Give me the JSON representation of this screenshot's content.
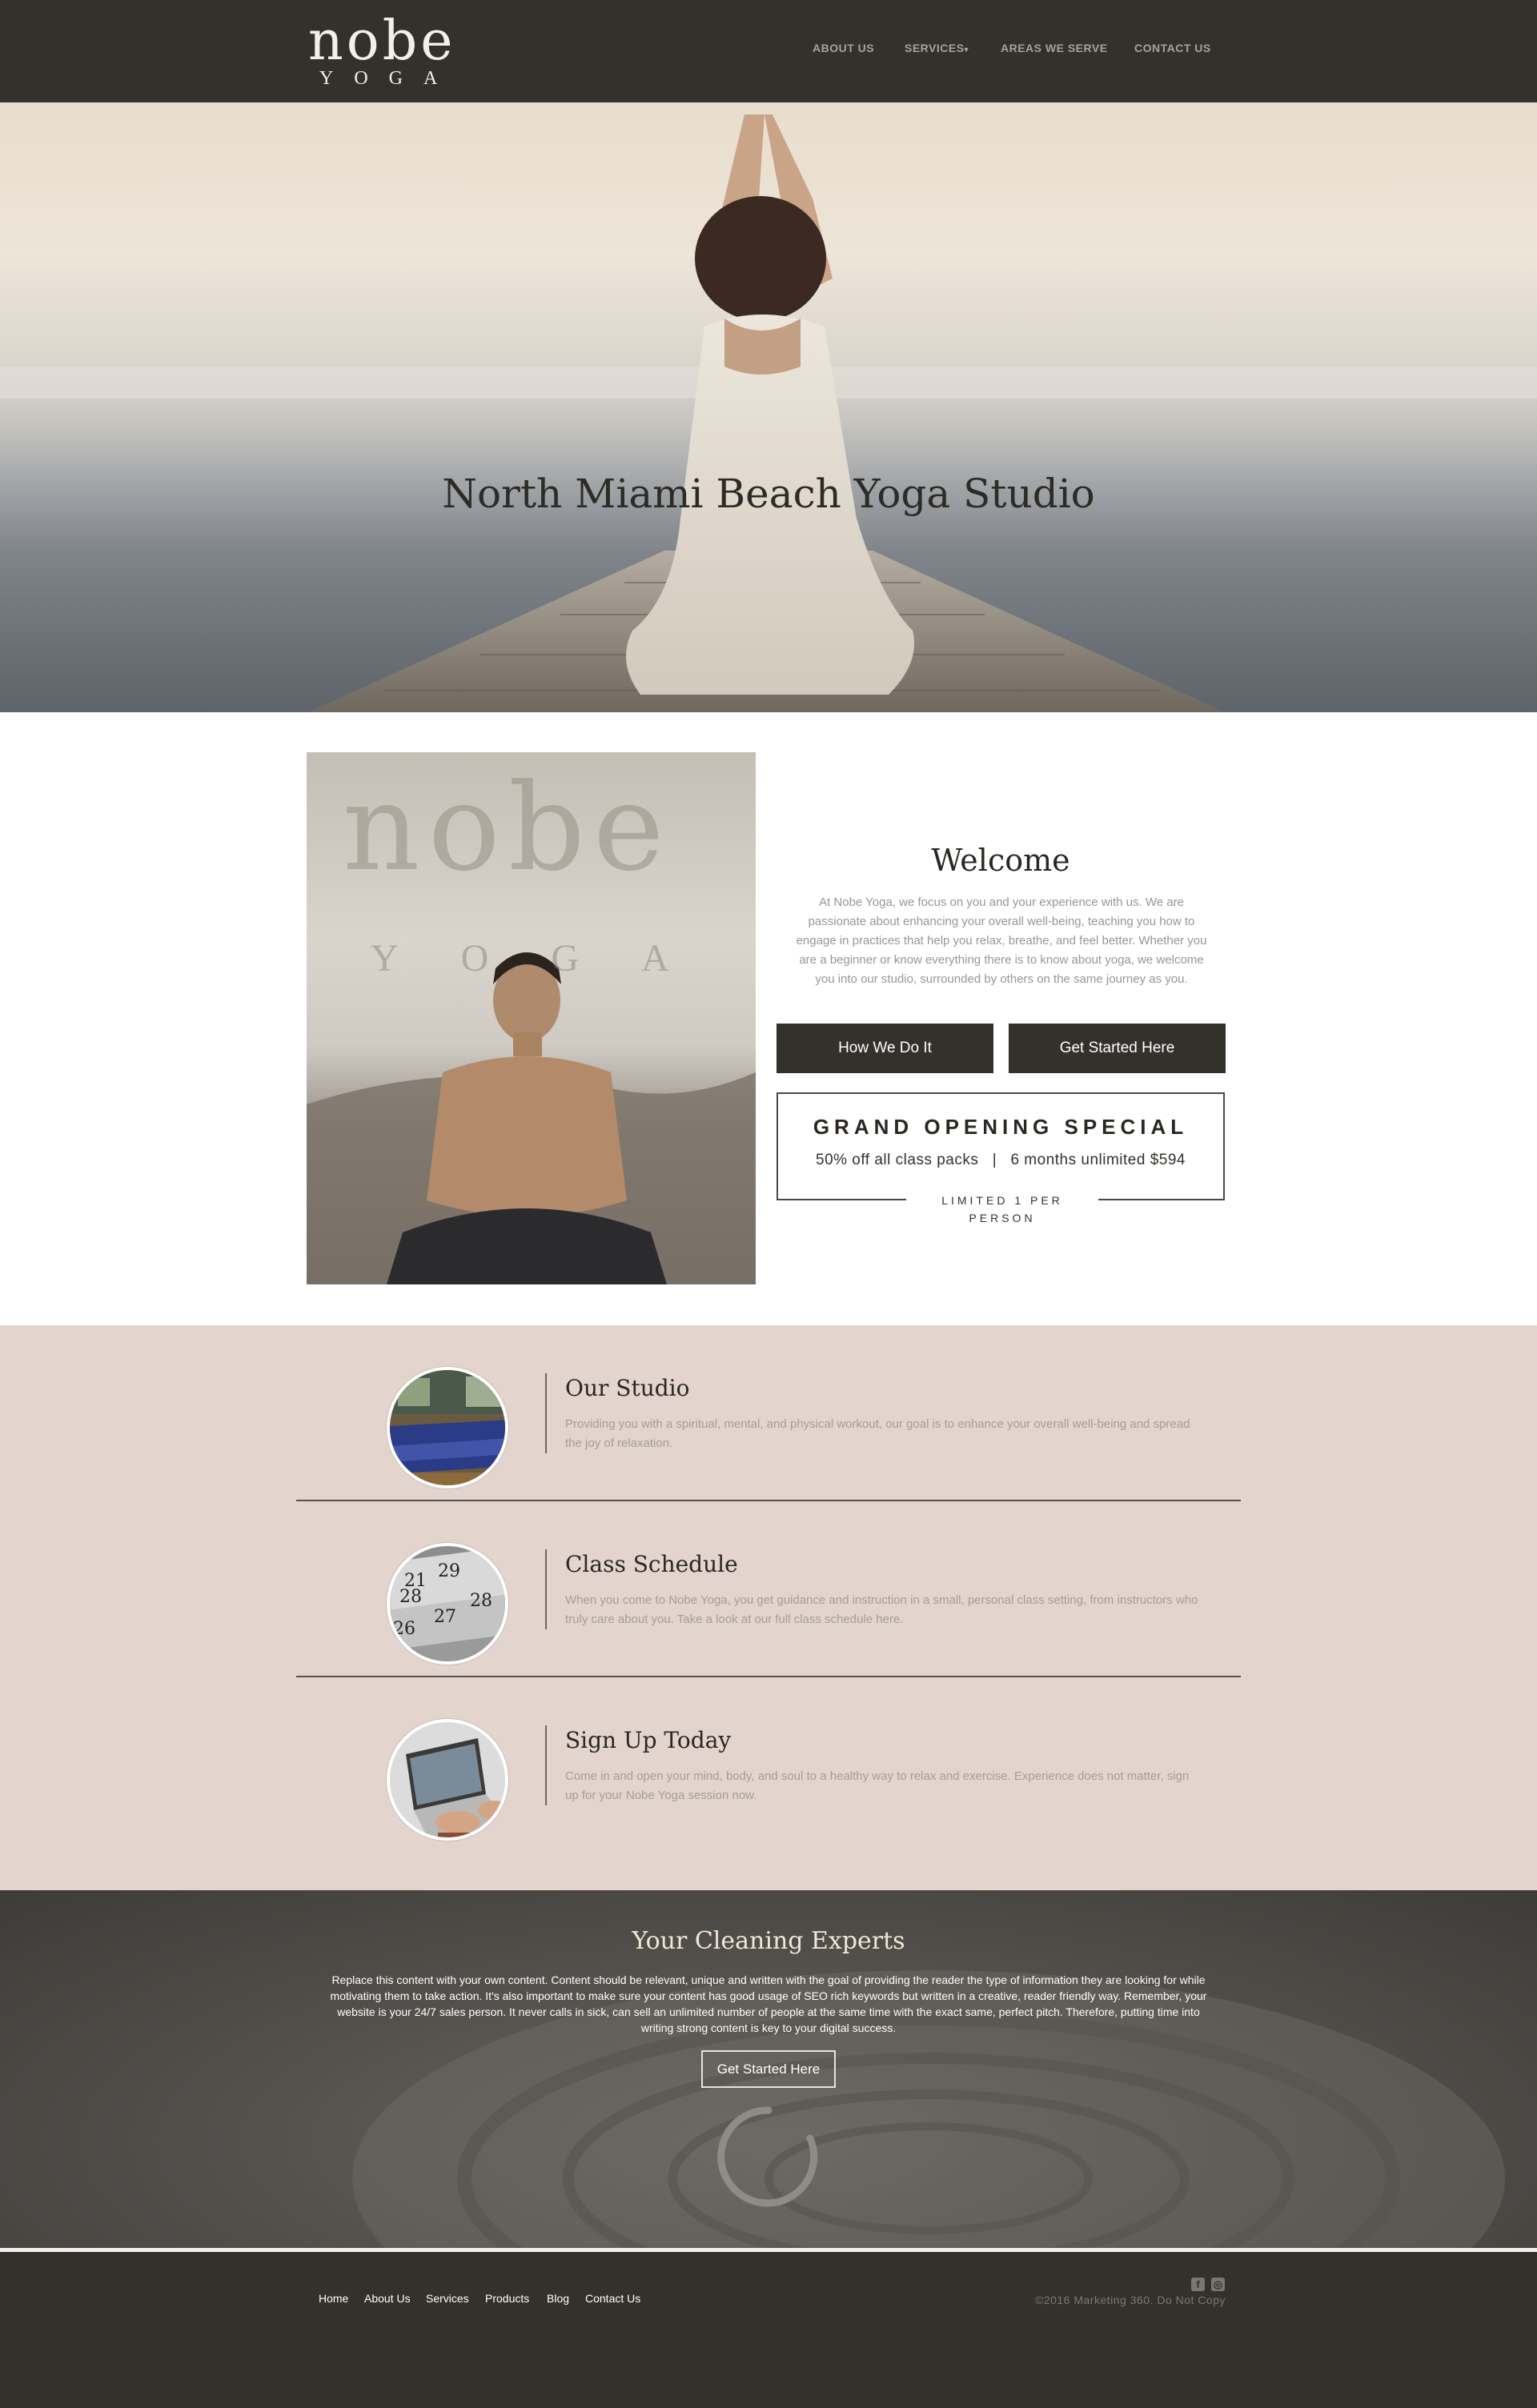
{
  "logo": {
    "main": "nobe",
    "sub": "YOGA"
  },
  "nav": {
    "about": "ABOUT US",
    "services": "SERVICES",
    "services_caret": "▾",
    "areas": "AREAS WE SERVE",
    "contact": "CONTACT US"
  },
  "hero": {
    "title": "North Miami Beach Yoga Studio"
  },
  "promo": {
    "logo_main": "nobe",
    "logo_sub": "YOGA"
  },
  "welcome": {
    "title": "Welcome",
    "text": "At Nobe Yoga, we focus on you and your experience with us. We are passionate about enhancing your overall well-being, teaching you how to engage in practices that help you relax, breathe, and feel better. Whether you are a beginner or know everything there is to know about yoga, we welcome you into our studio, surrounded by others on the same journey as you.",
    "btn_how": "How We Do It",
    "btn_start": "Get Started Here"
  },
  "special": {
    "title": "GRAND OPENING SPECIAL",
    "line": "50% off all class packs   |   6 months unlimited $594",
    "limit": "LIMITED 1 PER PERSON"
  },
  "features": [
    {
      "title": "Our Studio",
      "text": "Providing you with a spiritual, mental, and physical workout, our goal is to enhance your overall well-being and spread the joy of relaxation."
    },
    {
      "title": "Class Schedule",
      "text": "When you come to Nobe Yoga, you get guidance and instruction in a small, personal class setting, from instructors who truly care about you. Take a look at our full class schedule here."
    },
    {
      "title": "Sign Up Today",
      "text": "Come in and open your mind, body, and soul to a healthy way to relax and exercise. Experience does not matter, sign up for your Nobe Yoga session now."
    }
  ],
  "calendar_numbers": [
    "21",
    "29",
    "28",
    "27",
    "28",
    "26"
  ],
  "cta": {
    "title": "Your Cleaning Experts",
    "text": "Replace this content with your own content. Content should be relevant, unique and written with the goal of providing the reader the type of information they are looking for while motivating them to take action. It's also important to make sure your content has good usage of SEO rich keywords but written in a creative, reader friendly way. Remember, your website is your 24/7 sales person. It never calls in sick, can sell an unlimited number of people at the same time with the exact same, perfect pitch. Therefore, putting time into writing strong content is key to your digital success.",
    "button": "Get Started Here"
  },
  "footer": {
    "links": [
      "Home",
      "About Us",
      "Services",
      "Products",
      "Blog",
      "Contact Us"
    ],
    "social": [
      "f",
      "◎"
    ],
    "copyright": "©2016 Marketing 360. Do Not Copy"
  },
  "colors": {
    "header_bg": "#33312c",
    "features_bg": "#e3d4cd",
    "button_dark": "#33312c",
    "cta_title": "#f2e6d7"
  },
  "icons": [
    "facebook-icon",
    "instagram-icon",
    "enso-circle-icon"
  ]
}
